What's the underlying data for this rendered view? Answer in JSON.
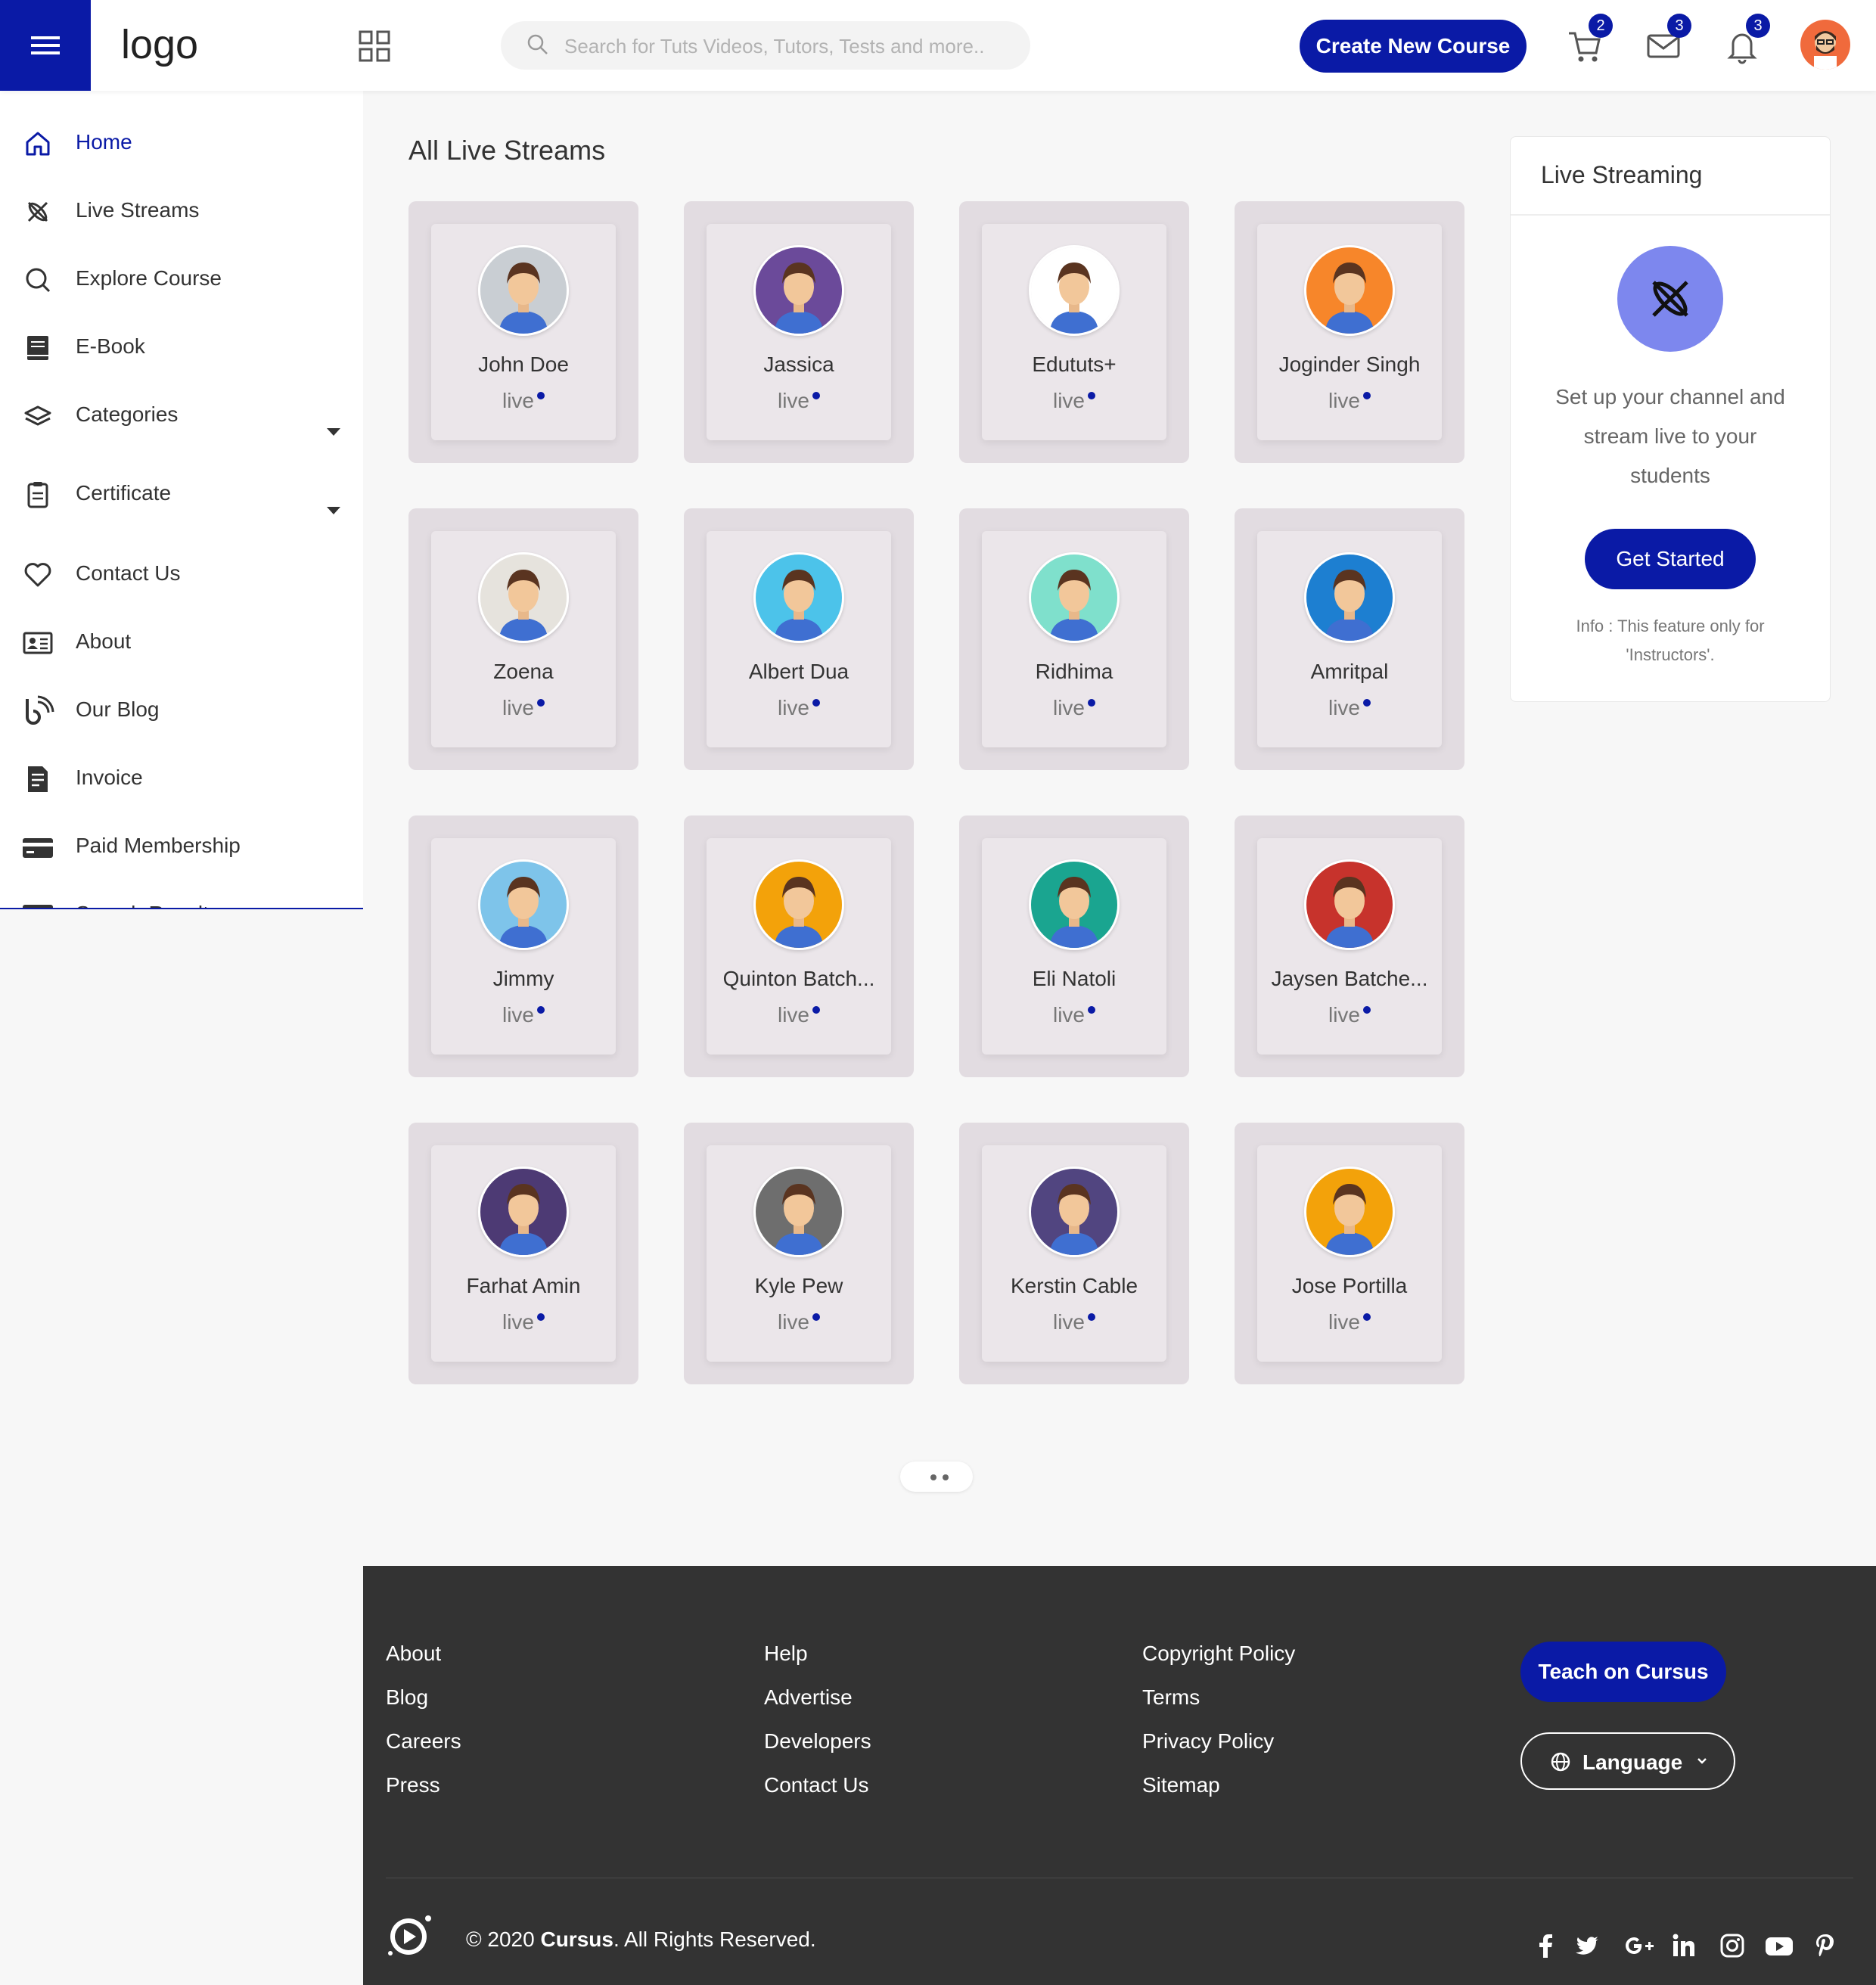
{
  "header": {
    "logo": "logo",
    "search_placeholder": "Search for Tuts Videos, Tutors, Tests and more..",
    "create_button": "Create New Course",
    "cart_badge": "2",
    "messages_badge": "3",
    "notifications_badge": "3"
  },
  "sidebar": {
    "items": [
      {
        "label": "Home",
        "icon": "home-icon"
      },
      {
        "label": "Live Streams",
        "icon": "broadcast-icon"
      },
      {
        "label": "Explore Course",
        "icon": "search-icon"
      },
      {
        "label": "E-Book",
        "icon": "book-icon"
      },
      {
        "label": "Categories",
        "icon": "layers-icon"
      },
      {
        "label": "Certificate",
        "icon": "clipboard-icon"
      },
      {
        "label": "Contact Us",
        "icon": "heart-icon"
      },
      {
        "label": "About",
        "icon": "id-card-icon"
      },
      {
        "label": "Our Blog",
        "icon": "blog-icon"
      },
      {
        "label": "Invoice",
        "icon": "invoice-icon"
      },
      {
        "label": "Paid Membership",
        "icon": "credit-card-icon"
      },
      {
        "label": "Search Results",
        "icon": "results-icon"
      }
    ]
  },
  "main": {
    "title": "All Live Streams",
    "live_label": "live",
    "streams": [
      {
        "name": "John Doe",
        "color": "#c9ced3"
      },
      {
        "name": "Jassica",
        "color": "#6b4a9a"
      },
      {
        "name": "Edututs+",
        "color": "#ffffff"
      },
      {
        "name": "Joginder Singh",
        "color": "#f7862a"
      },
      {
        "name": "Zoena",
        "color": "#e6e3dd"
      },
      {
        "name": "Albert Dua",
        "color": "#4cc3ea"
      },
      {
        "name": "Ridhima",
        "color": "#7fe0cc"
      },
      {
        "name": "Amritpal",
        "color": "#1d7fd1"
      },
      {
        "name": "Jimmy",
        "color": "#7ec4ea"
      },
      {
        "name": "Quinton Batch...",
        "color": "#f3a20a"
      },
      {
        "name": "Eli Natoli",
        "color": "#1aa590"
      },
      {
        "name": "Jaysen Batche...",
        "color": "#c7332c"
      },
      {
        "name": "Farhat Amin",
        "color": "#4d3a74"
      },
      {
        "name": "Kyle Pew",
        "color": "#6e6e6e"
      },
      {
        "name": "Kerstin Cable",
        "color": "#514580"
      },
      {
        "name": "Jose Portilla",
        "color": "#f3a20a"
      }
    ]
  },
  "panel": {
    "title": "Live Streaming",
    "text": "Set up your channel and stream live to your students",
    "button": "Get Started",
    "info": "Info : This feature only for 'Instructors'."
  },
  "footer": {
    "col1": [
      "About",
      "Blog",
      "Careers",
      "Press"
    ],
    "col2": [
      "Help",
      "Advertise",
      "Developers",
      "Contact Us"
    ],
    "col3": [
      "Copyright Policy",
      "Terms",
      "Privacy Policy",
      "Sitemap"
    ],
    "teach_button": "Teach on Cursus",
    "language_button": "Language",
    "copyright_prefix": "© 2020",
    "copyright_brand": "Cursus",
    "copyright_suffix": ". All Rights Reserved.",
    "social": [
      "facebook-icon",
      "twitter-icon",
      "google-plus-icon",
      "linkedin-icon",
      "instagram-icon",
      "youtube-icon",
      "pinterest-icon"
    ]
  },
  "colors": {
    "accent": "#0a1aa6",
    "footer_bg": "#333333",
    "card_bg": "#e2dce1"
  }
}
